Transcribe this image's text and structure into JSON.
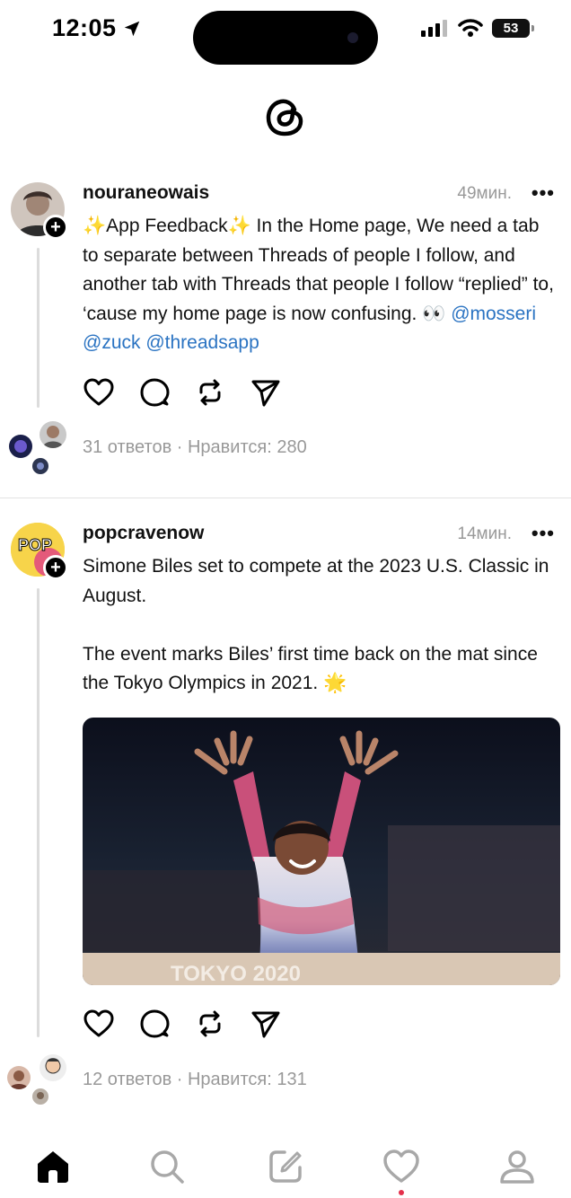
{
  "status_bar": {
    "time": "12:05",
    "battery": "53"
  },
  "posts": [
    {
      "username": "nouraneowais",
      "time": "49мин.",
      "more": "•••",
      "text_prefix": "✨App Feedback✨ In the Home page, We need a tab to separate between Threads of people I follow, and another tab with Threads that people I follow “replied” to, ‘cause my home page is now confusing. 👀 ",
      "mentions": [
        "@mosseri",
        "@zuck",
        "@threadsapp"
      ],
      "stats": "31 ответов · Нравится: 280"
    },
    {
      "username": "popcravenow",
      "time": "14мин.",
      "more": "•••",
      "text": "Simone Biles set to compete at the 2023 U.S. Classic in August.\n\nThe event marks Biles’ first time back on the mat since the Tokyo Olympics in 2021. 🌟",
      "avatar_text": "POP",
      "image_caption": "TOKYO 2020",
      "stats": "12 ответов · Нравится: 131"
    }
  ],
  "icons": {
    "status": [
      "location-arrow-icon",
      "signal-icon",
      "wifi-icon",
      "battery-icon"
    ],
    "actions": [
      "heart-icon",
      "comment-icon",
      "repost-icon",
      "send-icon"
    ],
    "tabs": [
      "home-icon",
      "search-icon",
      "compose-icon",
      "activity-heart-icon",
      "profile-icon"
    ]
  },
  "colors": {
    "mention": "#2a73c2",
    "muted": "#999999",
    "notification": "#e4304b"
  }
}
